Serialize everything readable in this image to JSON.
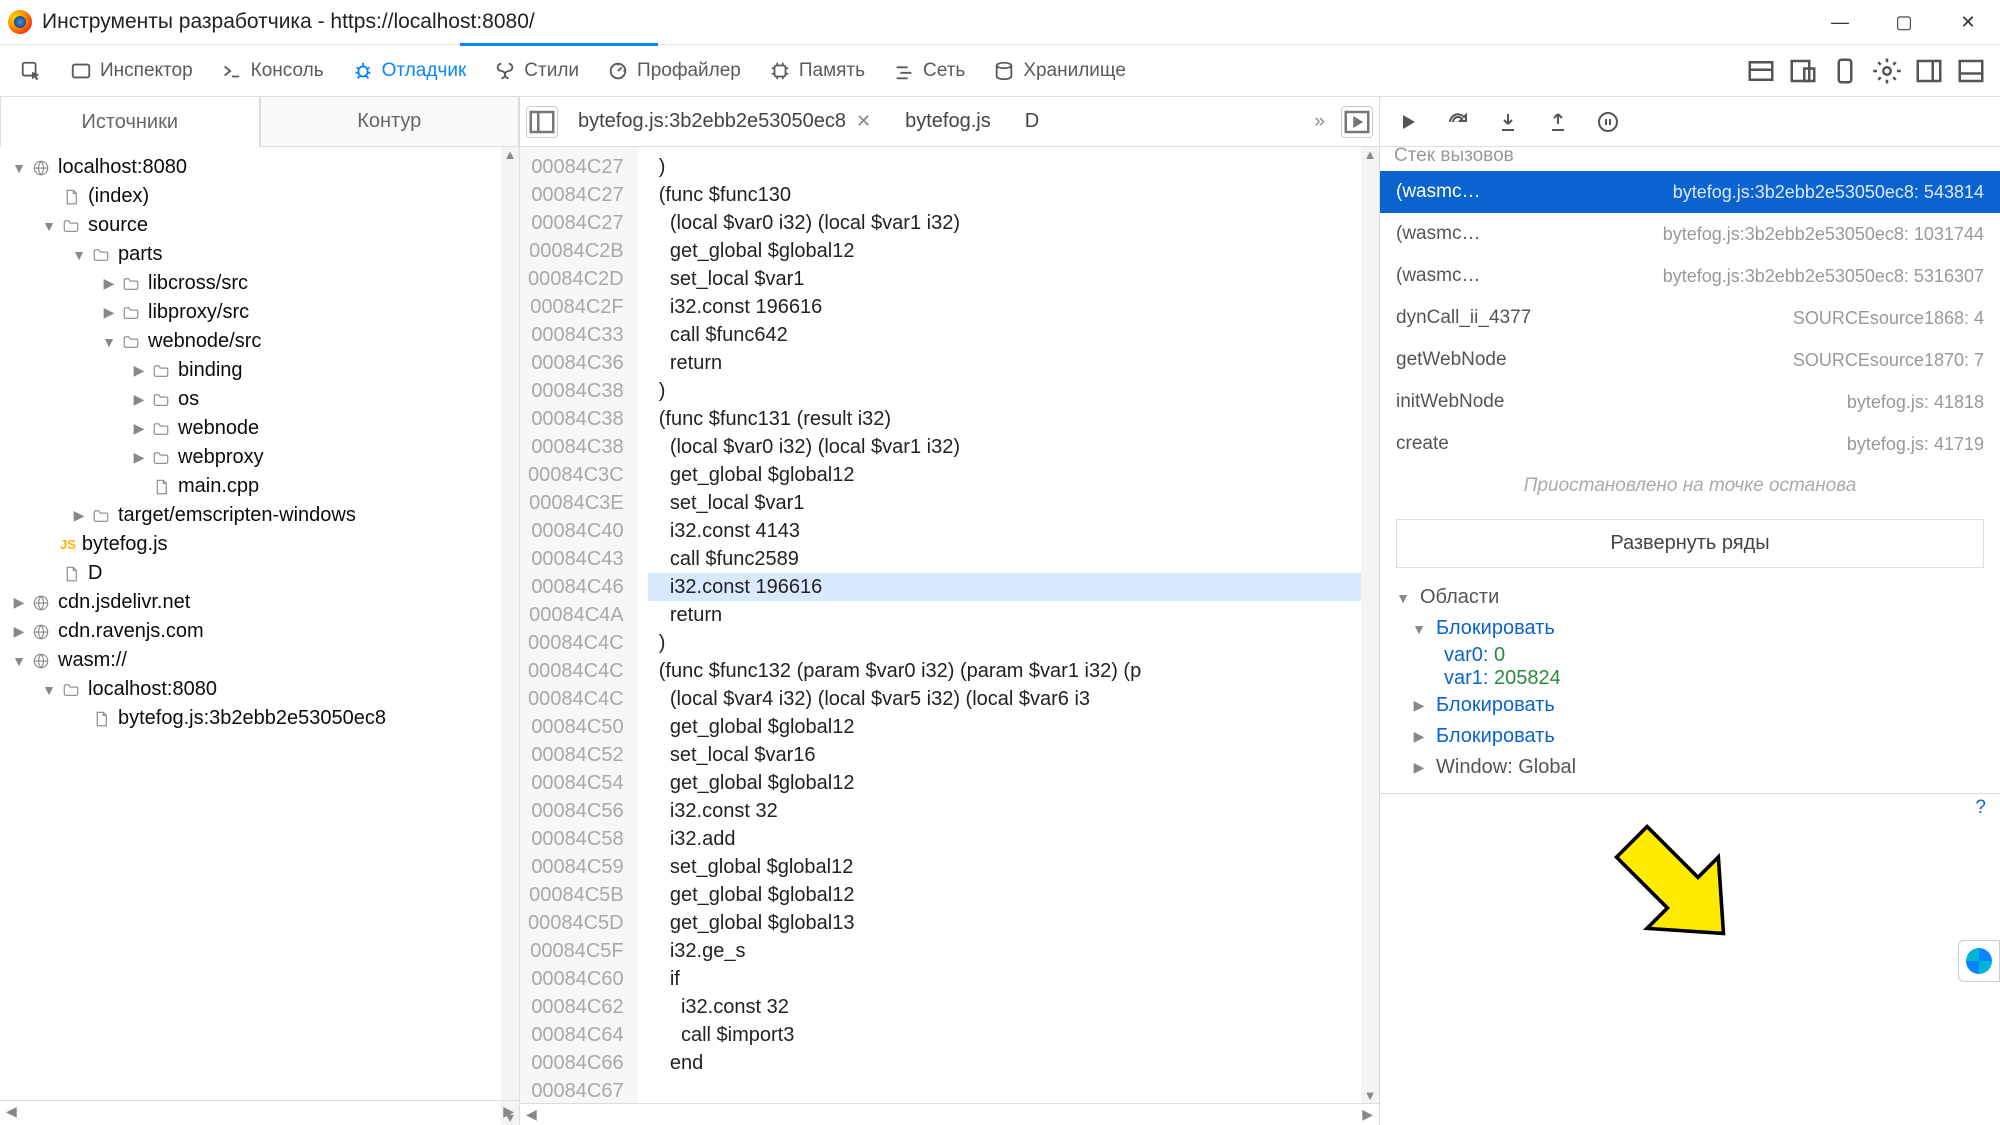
{
  "titlebar": {
    "title": "Инструменты разработчика - https://localhost:8080/"
  },
  "toolbar": {
    "inspector": "Инспектор",
    "console": "Консоль",
    "debugger": "Отладчик",
    "style": "Стили",
    "profiler": "Профайлер",
    "memory": "Память",
    "network": "Сеть",
    "storage": "Хранилище"
  },
  "left": {
    "tab_sources": "Источники",
    "tab_outline": "Контур",
    "tree": [
      {
        "ind": 0,
        "tw": "▼",
        "icon": "globe",
        "label": "localhost:8080"
      },
      {
        "ind": 1,
        "tw": "",
        "icon": "file",
        "label": "(index)"
      },
      {
        "ind": 1,
        "tw": "▼",
        "icon": "folder",
        "label": "source"
      },
      {
        "ind": 2,
        "tw": "▼",
        "icon": "folder",
        "label": "parts"
      },
      {
        "ind": 3,
        "tw": "▶",
        "icon": "folder",
        "label": "libcross/src"
      },
      {
        "ind": 3,
        "tw": "▶",
        "icon": "folder",
        "label": "libproxy/src"
      },
      {
        "ind": 3,
        "tw": "▼",
        "icon": "folder",
        "label": "webnode/src"
      },
      {
        "ind": 4,
        "tw": "▶",
        "icon": "folder",
        "label": "binding"
      },
      {
        "ind": 4,
        "tw": "▶",
        "icon": "folder",
        "label": "os"
      },
      {
        "ind": 4,
        "tw": "▶",
        "icon": "folder",
        "label": "webnode"
      },
      {
        "ind": 4,
        "tw": "▶",
        "icon": "folder",
        "label": "webproxy"
      },
      {
        "ind": 4,
        "tw": "",
        "icon": "file",
        "label": "main.cpp"
      },
      {
        "ind": 2,
        "tw": "▶",
        "icon": "folder",
        "label": "target/emscripten-windows"
      },
      {
        "ind": 1,
        "tw": "",
        "icon": "js",
        "label": "bytefog.js"
      },
      {
        "ind": 1,
        "tw": "",
        "icon": "file",
        "label": "D"
      },
      {
        "ind": 0,
        "tw": "▶",
        "icon": "globe",
        "label": "cdn.jsdelivr.net"
      },
      {
        "ind": 0,
        "tw": "▶",
        "icon": "globe",
        "label": "cdn.ravenjs.com"
      },
      {
        "ind": 0,
        "tw": "▼",
        "icon": "globe",
        "label": "wasm://"
      },
      {
        "ind": 1,
        "tw": "▼",
        "icon": "folder",
        "label": "localhost:8080"
      },
      {
        "ind": 2,
        "tw": "",
        "icon": "file",
        "label": "bytefog.js:3b2ebb2e53050ec8"
      }
    ]
  },
  "center": {
    "tab1": "bytefog.js:3b2ebb2e53050ec8",
    "tab2": "bytefog.js",
    "tab3": "D",
    "more": "»",
    "addresses": [
      "00084C27",
      "00084C27",
      "00084C27",
      "00084C2B",
      "00084C2D",
      "00084C2F",
      "00084C33",
      "00084C36",
      "00084C38",
      "00084C38",
      "00084C38",
      "00084C3C",
      "00084C3E",
      "00084C40",
      "00084C43",
      "00084C46",
      "00084C4A",
      "00084C4C",
      "00084C4C",
      "00084C4C",
      "00084C50",
      "00084C52",
      "00084C54",
      "00084C56",
      "00084C58",
      "00084C59",
      "00084C5B",
      "00084C5D",
      "00084C5F",
      "00084C60",
      "00084C62",
      "00084C64",
      "00084C66",
      "00084C67"
    ],
    "lines": [
      "  )",
      "  (func $func130",
      "    (local $var0 i32) (local $var1 i32)",
      "    get_global $global12",
      "    set_local $var1",
      "    i32.const 196616",
      "    call $func642",
      "    return",
      "  )",
      "  (func $func131 (result i32)",
      "    (local $var0 i32) (local $var1 i32)",
      "    get_global $global12",
      "    set_local $var1",
      "    i32.const 4143",
      "    call $func2589",
      "    i32.const 196616",
      "    return",
      "  )",
      "  (func $func132 (param $var0 i32) (param $var1 i32) (p",
      "    (local $var4 i32) (local $var5 i32) (local $var6 i3",
      "    get_global $global12",
      "    set_local $var16",
      "    get_global $global12",
      "    i32.const 32",
      "    i32.add",
      "    set_global $global12",
      "    get_global $global12",
      "    get_global $global13",
      "    i32.ge_s",
      "    if",
      "      i32.const 32",
      "      call $import3",
      "    end",
      ""
    ],
    "hl_index": 15
  },
  "right": {
    "section_stack": "Стек вызовов",
    "stack": [
      {
        "a": "(wasmc…",
        "b": "bytefog.js:3b2ebb2e53050ec8: 543814",
        "sel": true
      },
      {
        "a": "(wasmc…",
        "b": "bytefog.js:3b2ebb2e53050ec8: 1031744"
      },
      {
        "a": "(wasmc…",
        "b": "bytefog.js:3b2ebb2e53050ec8: 5316307"
      },
      {
        "a": "dynCall_ii_4377",
        "b": "SOURCEsource1868: 4"
      },
      {
        "a": "getWebNode",
        "b": "SOURCEsource1870: 7"
      },
      {
        "a": "initWebNode",
        "b": "bytefog.js: 41818"
      },
      {
        "a": "create",
        "b": "bytefog.js: 41719"
      }
    ],
    "paused": "Приостановлено на точке останова",
    "expand": "Развернуть ряды",
    "scopes_label": "Области",
    "block": "Блокировать",
    "var0_name": "var0",
    "var0_val": "0",
    "var1_name": "var1",
    "var1_val": "205824",
    "window_global": "Window: Global",
    "qmark": "?"
  }
}
